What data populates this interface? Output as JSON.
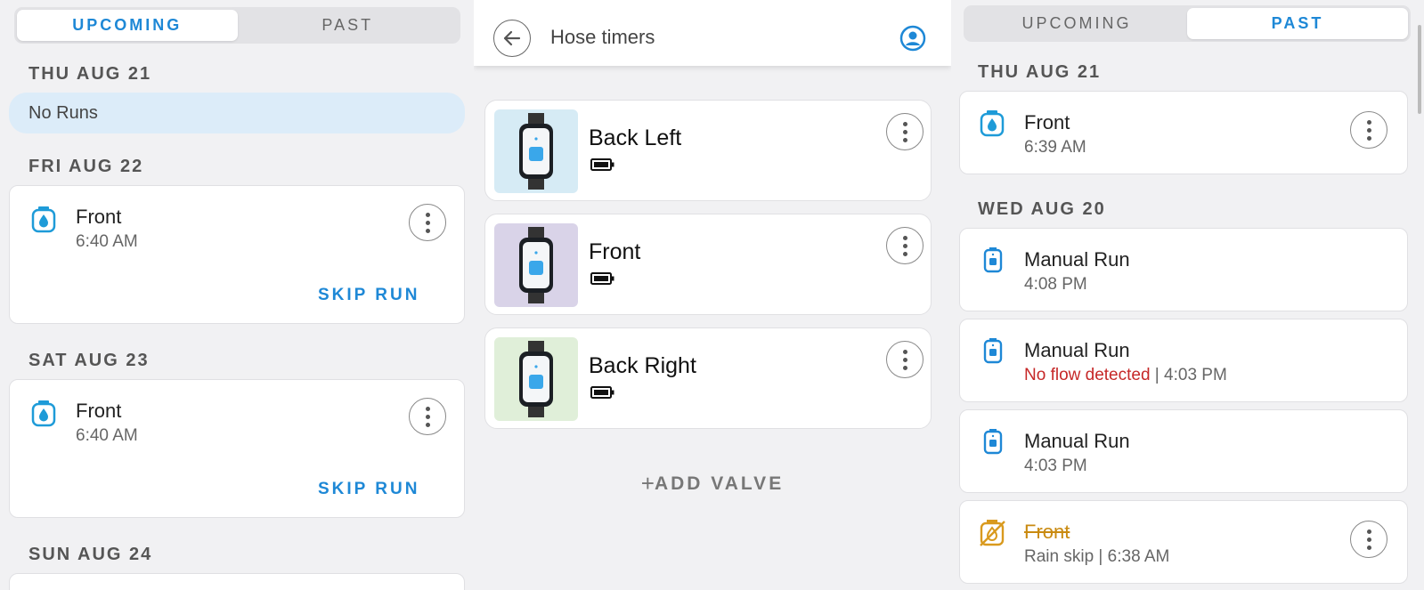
{
  "left": {
    "tabs": [
      "UPCOMING",
      "PAST"
    ],
    "days": [
      {
        "label": "THU AUG 21",
        "no_runs": "No Runs"
      },
      {
        "label": "FRI AUG 22",
        "card": {
          "title": "Front",
          "time": "6:40 AM",
          "action": "SKIP RUN"
        }
      },
      {
        "label": "SAT AUG 23",
        "card": {
          "title": "Front",
          "time": "6:40 AM",
          "action": "SKIP RUN"
        }
      },
      {
        "label": "SUN AUG 24"
      }
    ]
  },
  "mid": {
    "title": "Hose timers",
    "valves": [
      {
        "name": "Back Left",
        "bg": "#d6ebf5"
      },
      {
        "name": "Front",
        "bg": "#d9d3e8"
      },
      {
        "name": "Back Right",
        "bg": "#e0efd9"
      }
    ],
    "add_valve": "ADD VALVE"
  },
  "right": {
    "tabs": [
      "UPCOMING",
      "PAST"
    ],
    "days": [
      {
        "label": "THU AUG 21",
        "runs": [
          {
            "title": "Front",
            "time": "6:39 AM"
          }
        ]
      },
      {
        "label": "WED AUG 20",
        "runs": [
          {
            "title": "Manual Run",
            "time": "4:08 PM"
          },
          {
            "title": "Manual Run",
            "status": "No flow detected",
            "sep": " | ",
            "time": "4:03 PM"
          },
          {
            "title": "Manual Run",
            "time": "4:03 PM"
          },
          {
            "title": "Front",
            "status": "Rain skip",
            "sep": " | ",
            "time": "6:38 AM"
          }
        ]
      }
    ]
  },
  "colors": {
    "accent": "#1e88d6",
    "error": "#c62828",
    "skip": "#c98a10"
  }
}
